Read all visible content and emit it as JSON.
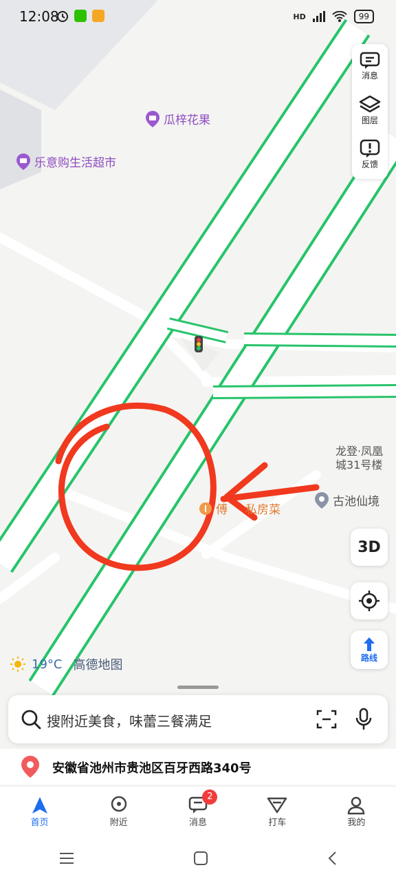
{
  "status_bar": {
    "time": "12:08",
    "network": "HD",
    "battery": "99"
  },
  "map": {
    "pois": [
      {
        "name": "瓜梓花果"
      },
      {
        "name": "乐意购生活超市"
      },
      {
        "name": "龙登·凤凰城31号楼"
      },
      {
        "name": "古池仙境"
      },
      {
        "name": "傅",
        "name2": "私房菜"
      }
    ],
    "weather": {
      "temp": "19°C",
      "provider": "高德地图"
    }
  },
  "side_tools": {
    "messages_label": "消息",
    "layers_label": "图层",
    "feedback_label": "反馈",
    "view3d_label": "3D",
    "route_label": "路线"
  },
  "search": {
    "placeholder": "搜附近美食，味蕾三餐满足"
  },
  "location": {
    "address": "安徽省池州市贵池区百牙西路340号"
  },
  "bottom_nav": {
    "items": [
      {
        "label": "首页"
      },
      {
        "label": "附近"
      },
      {
        "label": "消息",
        "badge": "2"
      },
      {
        "label": "打车"
      },
      {
        "label": "我的"
      }
    ]
  },
  "colors": {
    "road_outline": "#27c46a",
    "accent": "#1e6cf0",
    "annotation": "#f0391e"
  }
}
